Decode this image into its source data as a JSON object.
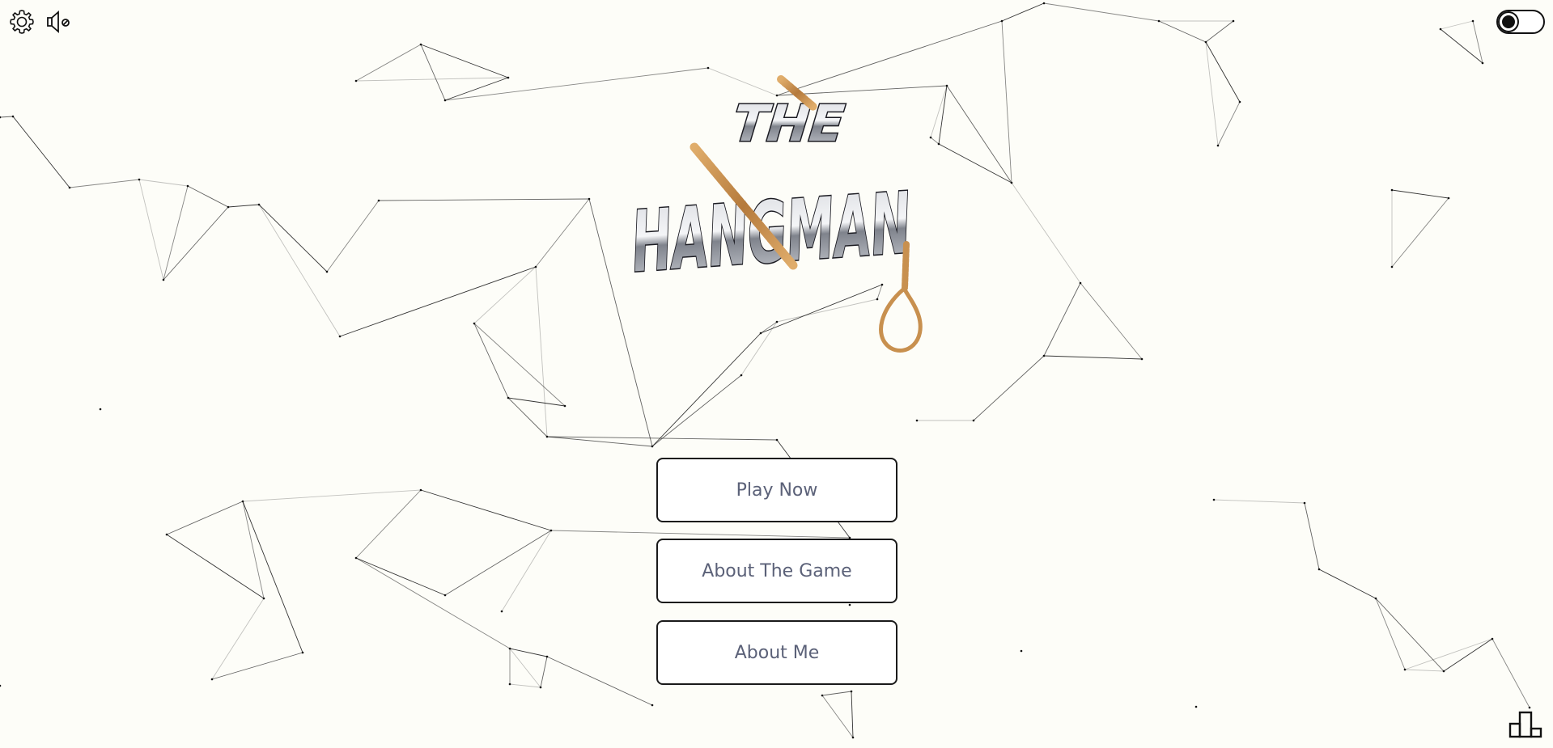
{
  "logo": {
    "line1": "THE",
    "line2": "HANGMAN"
  },
  "menu": {
    "play": "Play Now",
    "about_game": "About The Game",
    "about_me": "About Me"
  },
  "icons": {
    "settings": "gear-icon",
    "sound": "speaker-muted-icon",
    "theme": "dark-mode-toggle",
    "leaderboard": "podium-icon"
  },
  "colors": {
    "background": "#fdfdf8",
    "button_text": "#5b6178",
    "rope": "#c8904f"
  }
}
